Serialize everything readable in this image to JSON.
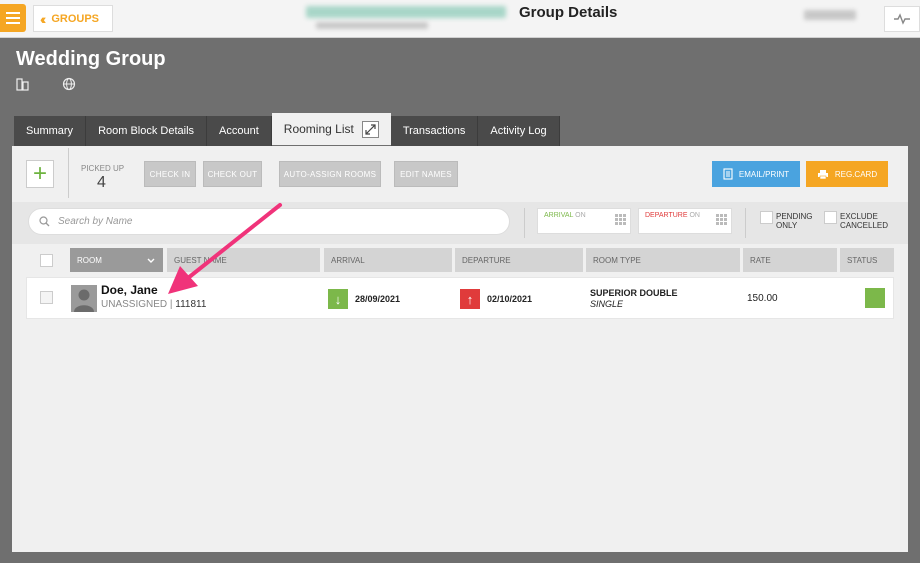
{
  "topbar": {
    "back_label": "GROUPS",
    "title": "Group Details"
  },
  "group": {
    "name": "Wedding Group"
  },
  "tabs": [
    {
      "label": "Summary"
    },
    {
      "label": "Room Block Details"
    },
    {
      "label": "Account"
    },
    {
      "label": "Rooming List"
    },
    {
      "label": "Transactions"
    },
    {
      "label": "Activity Log"
    }
  ],
  "toolbar": {
    "picked_up_label": "PICKED UP",
    "picked_up_value": "4",
    "check_in": "CHECK IN",
    "check_out": "CHECK OUT",
    "auto_assign": "AUTO-ASSIGN ROOMS",
    "edit_names": "EDIT NAMES",
    "email_print": "EMAIL/PRINT",
    "reg_card": "REG.CARD"
  },
  "filters": {
    "search_placeholder": "Search by Name",
    "arrival_label": "ARRIVAL",
    "departure_label": "DEPARTURE",
    "on_label": "ON",
    "pending_only": "PENDING ONLY",
    "exclude_cancelled": "EXCLUDE CANCELLED"
  },
  "columns": {
    "room": "ROOM",
    "guest_name": "GUEST NAME",
    "arrival": "ARRIVAL",
    "departure": "DEPARTURE",
    "room_type": "ROOM TYPE",
    "rate": "RATE",
    "status": "STATUS"
  },
  "rows": [
    {
      "guest_name": "Doe, Jane",
      "room": "UNASSIGNED",
      "confirmation": "111811",
      "arrival": "28/09/2021",
      "departure": "02/10/2021",
      "room_type": "SUPERIOR DOUBLE",
      "occupancy": "SINGLE",
      "rate": "150.00"
    }
  ],
  "colors": {
    "accent_orange": "#f5a623",
    "email_blue": "#4aa3df",
    "status_green": "#7cb84a",
    "arrival_green": "#7cb84a",
    "departure_red": "#e03b3b",
    "annotation_pink": "#f0337a"
  },
  "icons": {
    "menu": "hamburger-icon",
    "back": "double-chevron-left-icon",
    "building": "building-icon",
    "globe": "globe-icon",
    "expand": "expand-icon",
    "add": "plus-icon",
    "search": "search-icon",
    "email": "document-icon",
    "reg_card": "printer-icon",
    "arrival": "arrow-down-icon",
    "departure": "arrow-up-icon",
    "avatar": "person-avatar-icon",
    "annotation": "pointer-arrow-annotation"
  }
}
